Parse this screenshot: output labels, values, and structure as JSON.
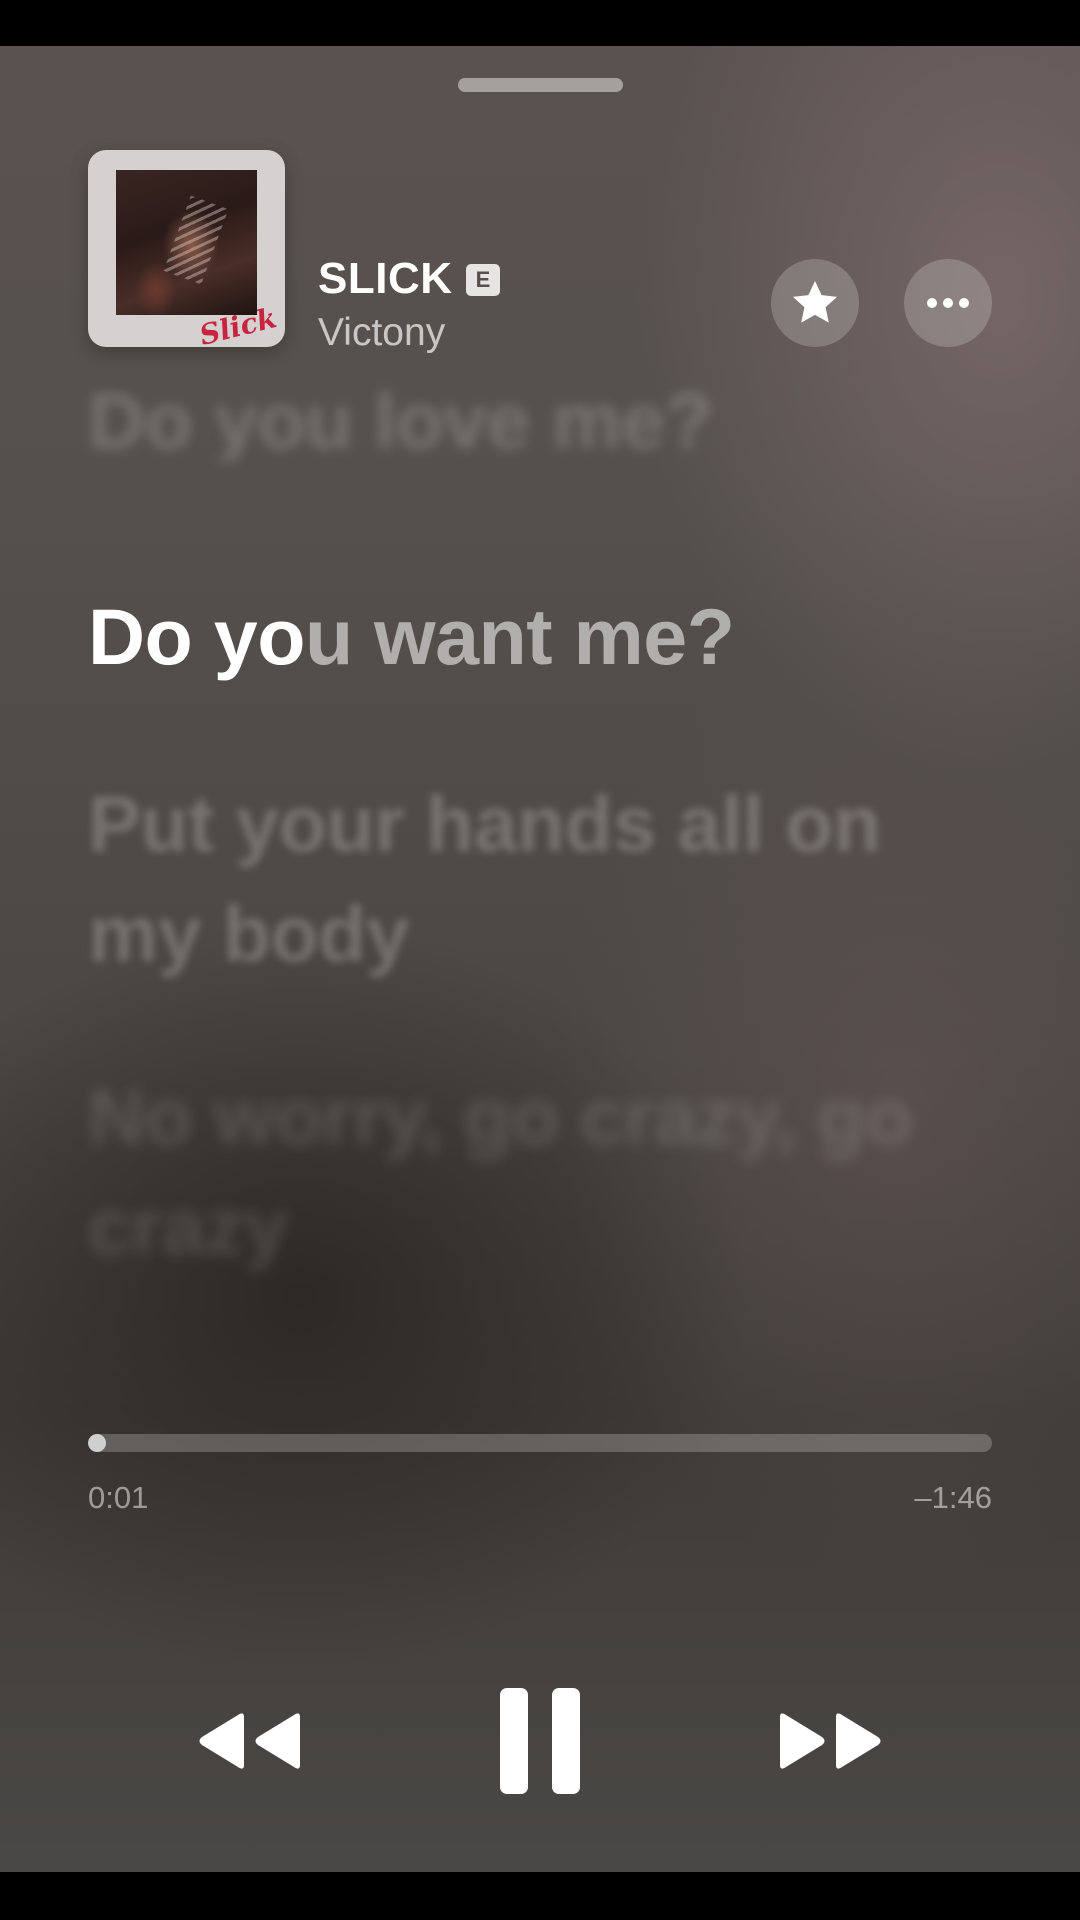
{
  "now_playing": {
    "title": "SLICK",
    "explicit_badge": "E",
    "artist": "Victony",
    "artwork_script": "Slick"
  },
  "actions": {
    "favorite_icon": "star-icon",
    "more_icon": "ellipsis-icon"
  },
  "lyrics": {
    "previous": "Do you love me?",
    "current_sung": "Do yo",
    "current_unsung": "u want me?",
    "next_1": "Put your hands all on my body",
    "next_2": "No worry, go crazy, go crazy"
  },
  "playback": {
    "elapsed": "0:01",
    "remaining": "–1:46",
    "progress_fraction": 0.009
  },
  "controls": {
    "rewind_icon": "backward-icon",
    "pause_icon": "pause-icon",
    "forward_icon": "forward-icon"
  },
  "colors": {
    "explicit_badge_text": "#55504d",
    "artwork_script": "#c8243f"
  }
}
